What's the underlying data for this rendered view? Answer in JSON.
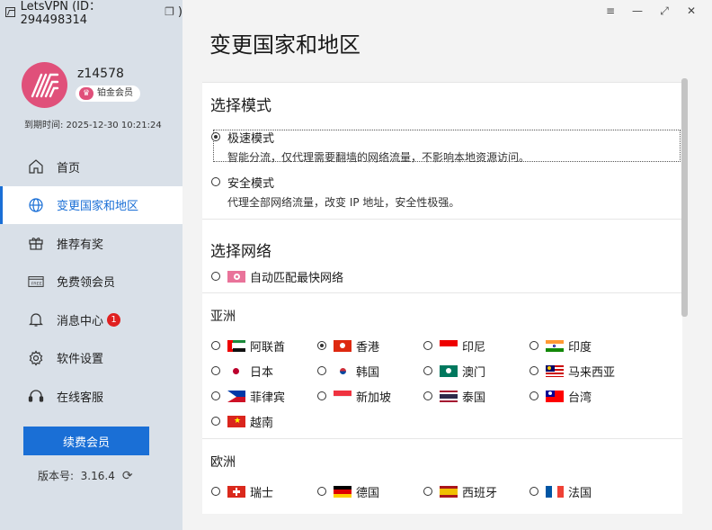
{
  "window": {
    "title": "LetsVPN (ID：294498314",
    "title_suffix": ")",
    "controls": [
      "≡",
      "—",
      "⤢",
      "✕"
    ]
  },
  "user": {
    "name": "z14578",
    "badge": "铂金会员",
    "expire": "到期时间: 2025-12-30 10:21:24"
  },
  "nav": {
    "items": [
      {
        "label": "首页",
        "icon": "home-icon"
      },
      {
        "label": "变更国家和地区",
        "icon": "globe-icon"
      },
      {
        "label": "推荐有奖",
        "icon": "gift-icon"
      },
      {
        "label": "免费领会员",
        "icon": "free-tag-icon"
      },
      {
        "label": "消息中心",
        "icon": "bell-icon",
        "badge": "1"
      },
      {
        "label": "软件设置",
        "icon": "gear-icon"
      },
      {
        "label": "在线客服",
        "icon": "headset-icon"
      }
    ],
    "active_index": 1
  },
  "renew_button": "续费会员",
  "version": "版本号:  3.16.4",
  "page": {
    "title": "变更国家和地区",
    "mode_section": "选择模式",
    "modes": [
      {
        "label": "极速模式",
        "desc": "智能分流，仅代理需要翻墙的网络流量，不影响本地资源访问。",
        "checked": true
      },
      {
        "label": "安全模式",
        "desc": "代理全部网络流量，改变 IP 地址，安全性极强。",
        "checked": false
      }
    ],
    "network_section": "选择网络",
    "auto_option": "自动匹配最快网络",
    "asia_title": "亚洲",
    "europe_title": "欧洲",
    "asia": [
      {
        "name": "阿联酋",
        "flag": "ae",
        "checked": false
      },
      {
        "name": "香港",
        "flag": "hk",
        "checked": true
      },
      {
        "name": "印尼",
        "flag": "id",
        "checked": false
      },
      {
        "name": "印度",
        "flag": "in",
        "checked": false
      },
      {
        "name": "日本",
        "flag": "jp",
        "checked": false
      },
      {
        "name": "韩国",
        "flag": "kr",
        "checked": false
      },
      {
        "name": "澳门",
        "flag": "mo",
        "checked": false
      },
      {
        "name": "马来西亚",
        "flag": "my",
        "checked": false
      },
      {
        "name": "菲律宾",
        "flag": "ph",
        "checked": false
      },
      {
        "name": "新加坡",
        "flag": "sg",
        "checked": false
      },
      {
        "name": "泰国",
        "flag": "th",
        "checked": false
      },
      {
        "name": "台湾",
        "flag": "tw",
        "checked": false
      },
      {
        "name": "越南",
        "flag": "vn",
        "checked": false
      }
    ],
    "europe": [
      {
        "name": "瑞士",
        "flag": "ch",
        "checked": false
      },
      {
        "name": "德国",
        "flag": "de",
        "checked": false
      },
      {
        "name": "西班牙",
        "flag": "es",
        "checked": false
      },
      {
        "name": "法国",
        "flag": "fr",
        "checked": false
      }
    ]
  },
  "colors": {
    "accent": "#1a6fd6",
    "sidebar": "#d9e0e8",
    "brand": "#e0507a",
    "notice": "#e02020"
  }
}
